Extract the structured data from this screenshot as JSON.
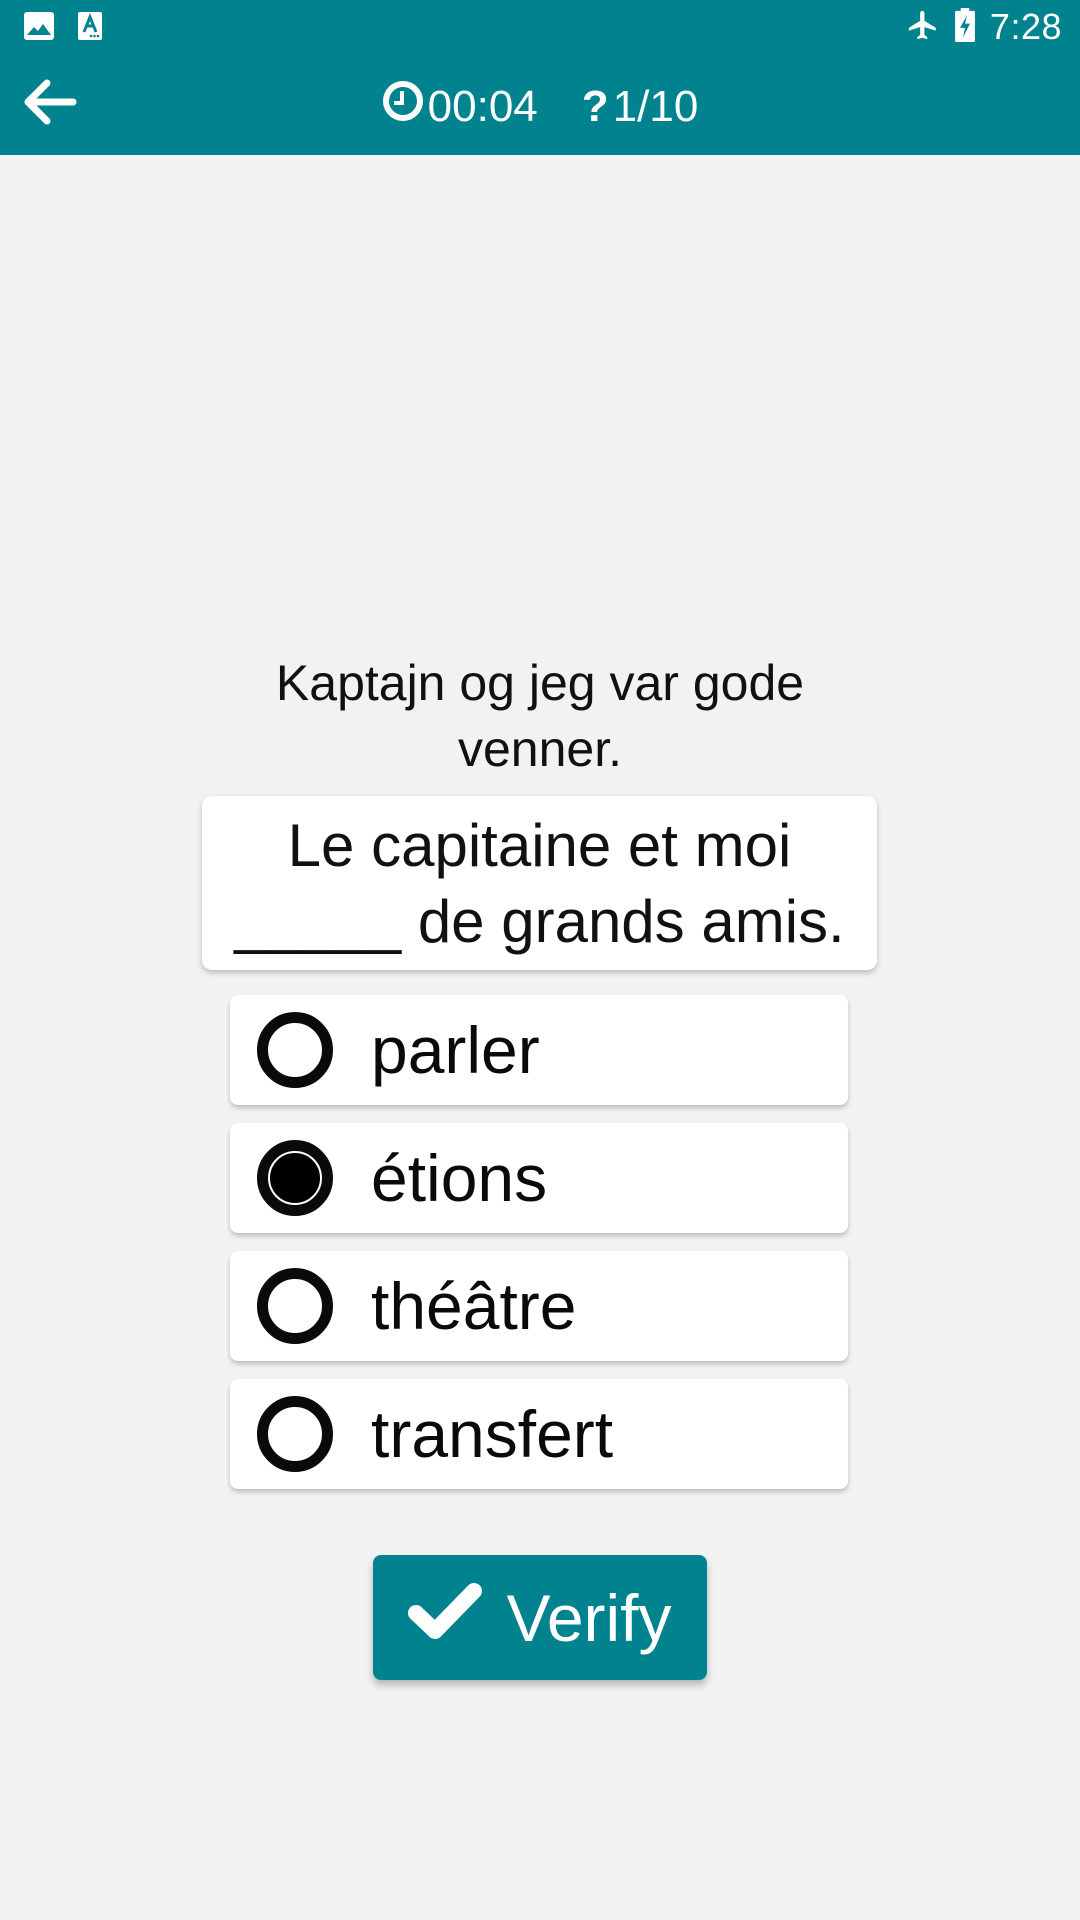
{
  "status_bar": {
    "left_icons": [
      "image-icon",
      "accessibility-font-icon"
    ],
    "right_icons": [
      "airplane-mode-icon",
      "battery-charging-icon"
    ],
    "time": "7:28"
  },
  "toolbar": {
    "back_icon": "arrow-left-icon",
    "timer_icon": "clock-icon",
    "timer": "00:04",
    "progress_icon": "question-icon",
    "progress": "1/10"
  },
  "colors": {
    "primary": "#00838F",
    "background": "#F2F2F2",
    "card": "#FFFFFF",
    "text": "#111111"
  },
  "question": {
    "prompt": "Kaptajn og jeg var gode venner.",
    "sentence_line1": "Le capitaine et moi",
    "sentence_line2": "_____ de grands amis."
  },
  "options": [
    {
      "label": "parler",
      "selected": false
    },
    {
      "label": "étions",
      "selected": true
    },
    {
      "label": "théâtre",
      "selected": false
    },
    {
      "label": "transfert",
      "selected": false
    }
  ],
  "verify_button": {
    "icon": "checkmark-icon",
    "label": "Verify"
  }
}
